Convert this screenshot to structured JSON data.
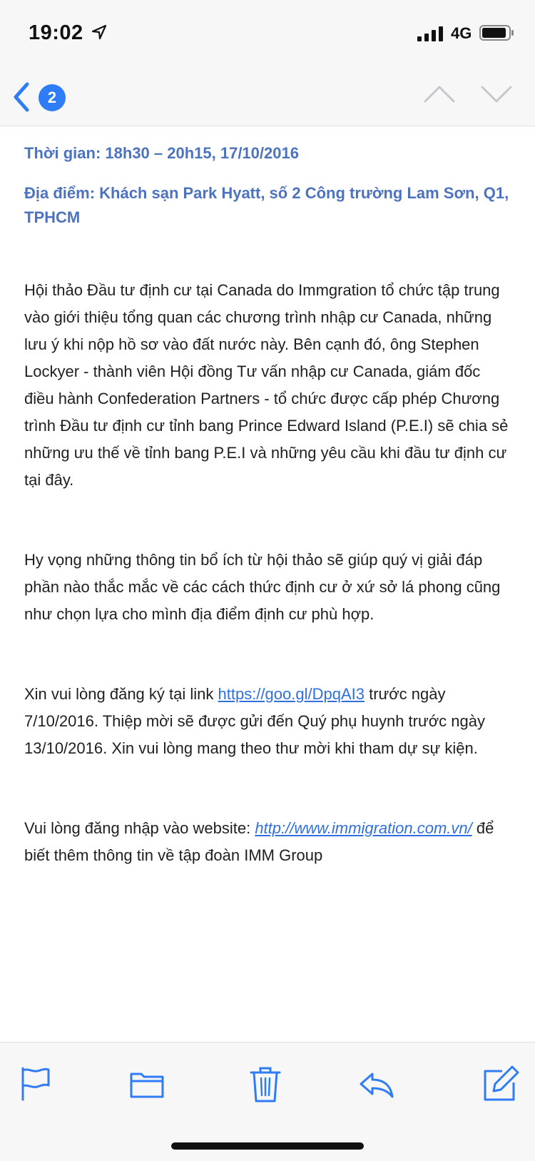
{
  "status_bar": {
    "time": "19:02",
    "network": "4G",
    "icons": [
      "location-arrow-icon",
      "signal-bars-icon",
      "battery-icon"
    ]
  },
  "nav": {
    "back_badge": "2",
    "icons": [
      "chevron-left-icon",
      "chevron-up-icon",
      "chevron-down-icon"
    ]
  },
  "email": {
    "time_detail": "Thời gian: 18h30 – 20h15, 17/10/2016",
    "venue_detail": "Địa điểm: Khách sạn Park Hyatt, số 2 Công trường Lam Sơn, Q1, TPHCM",
    "paragraph_1": "Hội thảo Đầu tư định cư tại Canada do Immgration tổ chức tập trung vào giới thiệu tổng quan các chương trình nhập cư Canada, những lưu ý khi nộp hồ sơ vào đất nước này. Bên cạnh đó, ông Stephen Lockyer - thành viên Hội đồng Tư vấn nhập cư Canada, giám đốc điều hành Confederation Partners - tổ chức được cấp phép Chương trình Đầu tư định cư tỉnh bang Prince Edward Island (P.E.I) sẽ chia sẻ những ưu thế về tỉnh bang P.E.I và những yêu cầu khi đầu tư định cư tại đây.",
    "paragraph_2": "Hy vọng những thông tin bổ ích từ hội thảo sẽ giúp quý vị giải đáp phần nào thắc mắc về các cách thức định cư ở xứ sở lá phong cũng như chọn lựa cho mình địa điểm định cư phù hợp.",
    "paragraph_3": {
      "before": "Xin vui lòng đăng ký tại link ",
      "link": "https://goo.gl/DpqAI3",
      "after": " trước ngày 7/10/2016. Thiệp mời sẽ được gửi đến Quý phụ huynh trước ngày 13/10/2016. Xin vui lòng mang theo thư mời khi tham dự sự kiện."
    },
    "paragraph_4": {
      "before": "Vui lòng đăng nhập vào website: ",
      "link": "http://www.immigration.com.vn/",
      "after": " để biết thêm thông tin về tập đoàn IMM Group"
    }
  },
  "toolbar": {
    "icons": [
      "flag-icon",
      "folder-icon",
      "trash-icon",
      "reply-icon",
      "compose-icon"
    ]
  },
  "colors": {
    "accent": "#2f7df6",
    "detail_text": "#4d73bf",
    "link": "#2f6fe0",
    "bar_background": "#f7f7f7"
  }
}
